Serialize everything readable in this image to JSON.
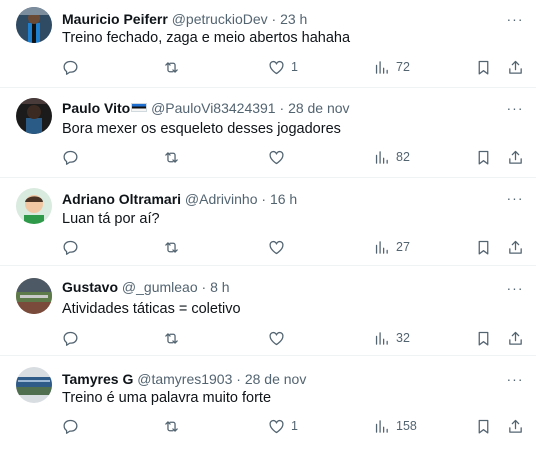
{
  "tweets": [
    {
      "name": "Mauricio Peiferr",
      "handle": "@petruckioDev",
      "sep": "·",
      "time": "23 h",
      "text": "Treino fechado, zaga e meio abertos hahaha",
      "replies": "",
      "retweets": "",
      "likes": "1",
      "views": "72",
      "avatar": "avatar-player-blue",
      "more": "···"
    },
    {
      "name": "Paulo Vito",
      "handle": "@PauloVi83424391",
      "sep": "·",
      "time": "28 de nov",
      "text": "Bora mexer os esqueleto desses jogadores",
      "replies": "",
      "retweets": "",
      "likes": "",
      "views": "82",
      "avatar": "avatar-player-dark",
      "more": "···"
    },
    {
      "name": "Adriano Oltramari",
      "handle": "@Adrivinho",
      "sep": "·",
      "time": "16 h",
      "text": "Luan tá por aí?",
      "replies": "",
      "retweets": "",
      "likes": "",
      "views": "27",
      "avatar": "avatar-portrait",
      "more": "···"
    },
    {
      "name": "Gustavo",
      "handle": "@_gumleao",
      "sep": "·",
      "time": "8 h",
      "text": "Atividades táticas = coletivo",
      "replies": "",
      "retweets": "",
      "likes": "",
      "views": "32",
      "avatar": "avatar-stadium",
      "more": "···"
    },
    {
      "name": "Tamyres G",
      "handle": "@tamyres1903",
      "sep": "·",
      "time": "28 de nov",
      "text": "Treino é uma palavra muito forte",
      "replies": "",
      "retweets": "",
      "likes": "1",
      "views": "158",
      "avatar": "avatar-arena",
      "more": "···"
    }
  ],
  "colors": {
    "text": "#0f1419",
    "secondary": "#536471",
    "divider": "#eff3f4"
  }
}
